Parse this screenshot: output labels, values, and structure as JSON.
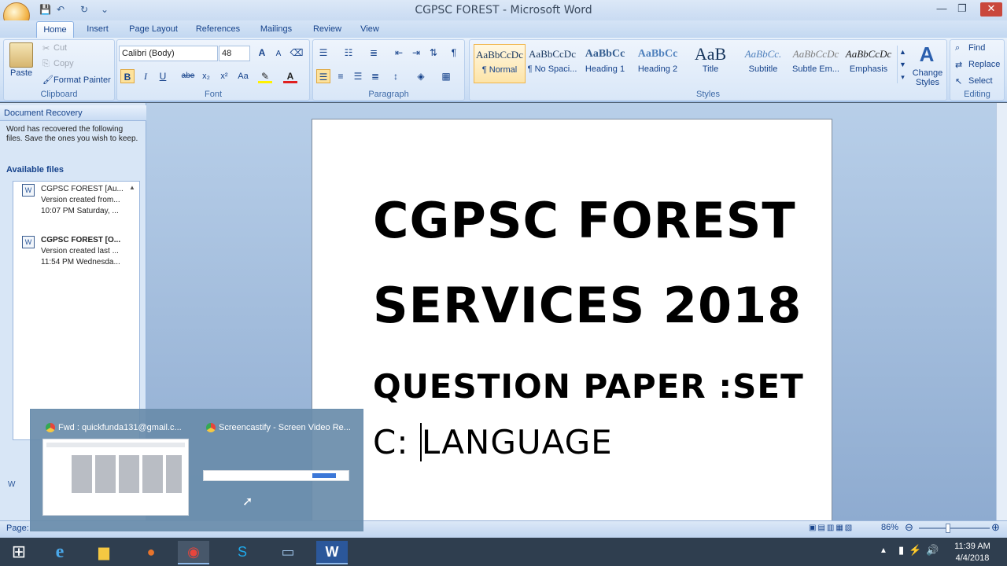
{
  "window": {
    "title": "CGPSC FOREST - Microsoft Word"
  },
  "quick_access": {
    "save": "💾",
    "undo": "↶",
    "redo": "↻",
    "customize": "⌄"
  },
  "window_controls": {
    "minimize": "—",
    "maximize": "❐",
    "close": "✕"
  },
  "tabs": [
    "Home",
    "Insert",
    "Page Layout",
    "References",
    "Mailings",
    "Review",
    "View"
  ],
  "clipboard": {
    "paste": "Paste",
    "cut": "Cut",
    "copy": "Copy",
    "format_painter": "Format Painter",
    "label": "Clipboard"
  },
  "font": {
    "name": "Calibri (Body)",
    "size": "48",
    "label": "Font",
    "bold": "B",
    "italic": "I",
    "underline": "U",
    "strike": "abe",
    "subscript": "x₂",
    "superscript": "x²",
    "case": "Aa",
    "grow": "A",
    "shrink": "A"
  },
  "paragraph": {
    "label": "Paragraph",
    "pilcrow": "¶"
  },
  "styles": {
    "label": "Styles",
    "items": [
      {
        "sample": "AaBbCcDc",
        "name": "¶ Normal"
      },
      {
        "sample": "AaBbCcDc",
        "name": "¶ No Spaci..."
      },
      {
        "sample": "AaBbCc",
        "name": "Heading 1"
      },
      {
        "sample": "AaBbCc",
        "name": "Heading 2"
      },
      {
        "sample": "AaB",
        "name": "Title"
      },
      {
        "sample": "AaBbCc.",
        "name": "Subtitle"
      },
      {
        "sample": "AaBbCcDc",
        "name": "Subtle Em..."
      },
      {
        "sample": "AaBbCcDc",
        "name": "Emphasis"
      }
    ],
    "change_styles": "Change Styles"
  },
  "editing": {
    "find": "Find",
    "replace": "Replace",
    "select": "Select",
    "label": "Editing"
  },
  "recovery": {
    "header": "Document Recovery",
    "message": "Word has recovered the following files.  Save the ones you wish to keep.",
    "available": "Available files",
    "files": [
      {
        "name": "CGPSC FOREST  [Au...",
        "line2": "Version created from...",
        "line3": "10:07 PM Saturday, ..."
      },
      {
        "name": "CGPSC FOREST  [O...",
        "line2": "Version created last ...",
        "line3": "11:54 PM Wednesda..."
      }
    ],
    "bottom_link": "W"
  },
  "document": {
    "line1": "CGPSC FOREST",
    "line2": "SERVICES 2018",
    "line3": "QUESTION PAPER :SET",
    "line4a": "C: ",
    "line4b": "LANGUAGE"
  },
  "status": {
    "page": "Page:",
    "zoom": "86%",
    "zoom_out": "⊖",
    "zoom_in": "⊕"
  },
  "taskbar_preview": {
    "item1": "Fwd : quickfunda131@gmail.c...",
    "item2": "Screencastify - Screen Video Re..."
  },
  "tray": {
    "time": "11:39 AM",
    "date": "4/4/2018"
  },
  "taskbar": {
    "start": "⊞"
  }
}
